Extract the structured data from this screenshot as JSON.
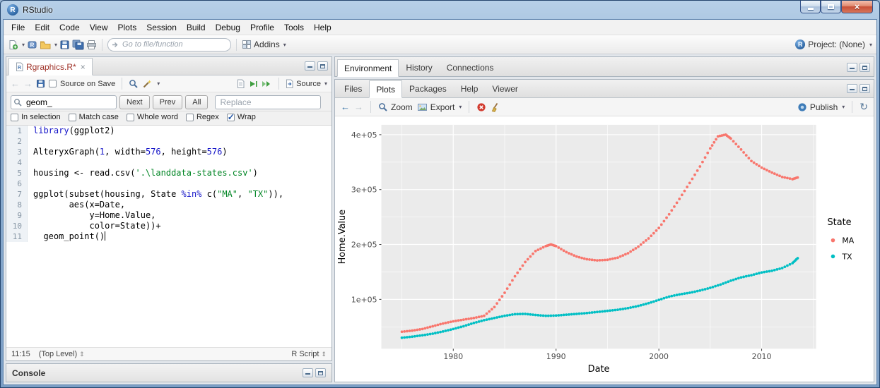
{
  "window": {
    "title": "RStudio"
  },
  "menu": {
    "items": [
      "File",
      "Edit",
      "Code",
      "View",
      "Plots",
      "Session",
      "Build",
      "Debug",
      "Profile",
      "Tools",
      "Help"
    ]
  },
  "toolbar": {
    "goto_placeholder": "Go to file/function",
    "addins_label": "Addins",
    "project_label": "Project: (None)"
  },
  "source_pane": {
    "tab": "Rgraphics.R*",
    "source_on_save_label": "Source on Save",
    "source_button_label": "Source",
    "find": {
      "query": "geom_",
      "next_label": "Next",
      "prev_label": "Prev",
      "all_label": "All",
      "replace_placeholder": "Replace",
      "options": [
        {
          "label": "In selection",
          "checked": false
        },
        {
          "label": "Match case",
          "checked": false
        },
        {
          "label": "Whole word",
          "checked": false
        },
        {
          "label": "Regex",
          "checked": false
        },
        {
          "label": "Wrap",
          "checked": true
        }
      ]
    },
    "code": [
      {
        "n": 1,
        "segments": [
          {
            "t": "library",
            "c": "kw"
          },
          {
            "t": "(ggplot2)",
            "c": "plain"
          }
        ]
      },
      {
        "n": 2,
        "segments": []
      },
      {
        "n": 3,
        "segments": [
          {
            "t": "AlteryxGraph(",
            "c": "plain"
          },
          {
            "t": "1",
            "c": "num"
          },
          {
            "t": ", width=",
            "c": "plain"
          },
          {
            "t": "576",
            "c": "num"
          },
          {
            "t": ", height=",
            "c": "plain"
          },
          {
            "t": "576",
            "c": "num"
          },
          {
            "t": ")",
            "c": "plain"
          }
        ]
      },
      {
        "n": 4,
        "segments": []
      },
      {
        "n": 5,
        "segments": [
          {
            "t": "housing <- read.csv(",
            "c": "plain"
          },
          {
            "t": "'.\\landdata-states.csv'",
            "c": "str"
          },
          {
            "t": ")",
            "c": "plain"
          }
        ]
      },
      {
        "n": 6,
        "segments": []
      },
      {
        "n": 7,
        "segments": [
          {
            "t": "ggplot(subset(housing, State ",
            "c": "plain"
          },
          {
            "t": "%in%",
            "c": "kw"
          },
          {
            "t": " c(",
            "c": "plain"
          },
          {
            "t": "\"MA\"",
            "c": "str"
          },
          {
            "t": ", ",
            "c": "plain"
          },
          {
            "t": "\"TX\"",
            "c": "str"
          },
          {
            "t": ")),",
            "c": "plain"
          }
        ]
      },
      {
        "n": 8,
        "segments": [
          {
            "t": "       aes(x=Date,",
            "c": "plain"
          }
        ]
      },
      {
        "n": 9,
        "segments": [
          {
            "t": "           y=Home.Value,",
            "c": "plain"
          }
        ]
      },
      {
        "n": 10,
        "segments": [
          {
            "t": "           color=State))+",
            "c": "plain"
          }
        ]
      },
      {
        "n": 11,
        "segments": [
          {
            "t": "  geom_point()",
            "c": "plain"
          }
        ],
        "cursor": true
      }
    ],
    "status": {
      "position": "11:15",
      "scope": "(Top Level)",
      "file_type": "R Script"
    }
  },
  "console_pane": {
    "title": "Console"
  },
  "environment_pane": {
    "tabs": [
      "Environment",
      "History",
      "Connections"
    ],
    "active": "Environment"
  },
  "files_pane": {
    "tabs": [
      "Files",
      "Plots",
      "Packages",
      "Help",
      "Viewer"
    ],
    "active": "Plots",
    "toolbar": {
      "zoom_label": "Zoom",
      "export_label": "Export",
      "publish_label": "Publish"
    }
  },
  "chart_data": {
    "type": "scatter",
    "title": "",
    "xlabel": "Date",
    "ylabel": "Home.Value",
    "xlim": [
      1973,
      2015.3
    ],
    "ylim": [
      10000,
      418000
    ],
    "xticks": [
      1980,
      1990,
      2000,
      2010
    ],
    "x_minor": [
      1975,
      1985,
      1995,
      2005,
      2015
    ],
    "yticks": [
      100000,
      200000,
      300000,
      400000
    ],
    "ytick_labels": [
      "1e+05",
      "2e+05",
      "3e+05",
      "4e+05"
    ],
    "y_minor": [
      50000,
      150000,
      250000,
      350000
    ],
    "grid": true,
    "panel_color": "#EBEBEB",
    "grid_color": "#FFFFFF",
    "legend_title": "State",
    "legend_position": "right",
    "series": [
      {
        "name": "MA",
        "color": "#F8766D",
        "points": [
          [
            1975,
            41000
          ],
          [
            1976,
            43000
          ],
          [
            1977,
            46000
          ],
          [
            1978,
            51000
          ],
          [
            1979,
            56000
          ],
          [
            1980,
            60000
          ],
          [
            1981,
            63000
          ],
          [
            1982,
            66000
          ],
          [
            1983,
            70000
          ],
          [
            1984,
            86000
          ],
          [
            1985,
            112000
          ],
          [
            1986,
            142000
          ],
          [
            1987,
            168000
          ],
          [
            1988,
            188000
          ],
          [
            1989,
            197000
          ],
          [
            1989.5,
            200000
          ],
          [
            1990,
            197000
          ],
          [
            1991,
            186000
          ],
          [
            1992,
            178000
          ],
          [
            1993,
            173000
          ],
          [
            1994,
            171000
          ],
          [
            1995,
            172000
          ],
          [
            1996,
            176000
          ],
          [
            1997,
            184000
          ],
          [
            1998,
            196000
          ],
          [
            1999,
            211000
          ],
          [
            2000,
            230000
          ],
          [
            2001,
            255000
          ],
          [
            2002,
            283000
          ],
          [
            2003,
            312000
          ],
          [
            2004,
            342000
          ],
          [
            2005,
            375000
          ],
          [
            2005.75,
            397000
          ],
          [
            2006.5,
            400000
          ],
          [
            2007,
            393000
          ],
          [
            2008,
            373000
          ],
          [
            2009,
            352000
          ],
          [
            2010,
            340000
          ],
          [
            2011,
            331000
          ],
          [
            2012,
            323000
          ],
          [
            2013,
            319000
          ],
          [
            2013.5,
            322000
          ]
        ]
      },
      {
        "name": "TX",
        "color": "#00BFC4",
        "points": [
          [
            1975,
            30000
          ],
          [
            1976,
            32000
          ],
          [
            1977,
            34500
          ],
          [
            1978,
            37500
          ],
          [
            1979,
            41500
          ],
          [
            1980,
            46000
          ],
          [
            1981,
            51000
          ],
          [
            1982,
            57000
          ],
          [
            1983,
            62000
          ],
          [
            1984,
            66000
          ],
          [
            1985,
            70000
          ],
          [
            1986,
            73000
          ],
          [
            1987,
            73500
          ],
          [
            1988,
            71500
          ],
          [
            1989,
            70000
          ],
          [
            1990,
            70500
          ],
          [
            1991,
            72000
          ],
          [
            1992,
            73500
          ],
          [
            1993,
            75000
          ],
          [
            1994,
            77000
          ],
          [
            1995,
            79000
          ],
          [
            1996,
            81000
          ],
          [
            1997,
            84000
          ],
          [
            1998,
            88000
          ],
          [
            1999,
            93000
          ],
          [
            2000,
            99000
          ],
          [
            2001,
            105000
          ],
          [
            2002,
            109000
          ],
          [
            2003,
            112000
          ],
          [
            2004,
            116000
          ],
          [
            2005,
            121000
          ],
          [
            2006,
            127000
          ],
          [
            2007,
            134000
          ],
          [
            2008,
            140000
          ],
          [
            2009,
            144000
          ],
          [
            2010,
            149000
          ],
          [
            2011,
            152000
          ],
          [
            2012,
            157000
          ],
          [
            2013,
            166000
          ],
          [
            2013.5,
            175000
          ]
        ]
      }
    ]
  }
}
